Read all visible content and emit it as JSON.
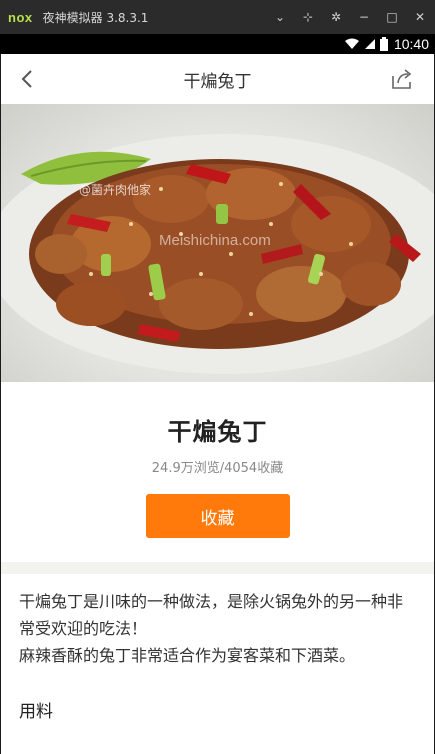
{
  "emulator": {
    "logo": "nox",
    "title": "夜神模拟器 3.8.3.1"
  },
  "status_bar": {
    "time": "10:40"
  },
  "header": {
    "title": "干煸兔丁"
  },
  "hero": {
    "watermark_1": "@菌卉肉他家",
    "watermark_2": "Meishichina.com"
  },
  "recipe": {
    "name": "干煸兔丁",
    "stats": "24.9万浏览/4054收藏",
    "favorite_label": "收藏"
  },
  "description": {
    "line1": "干煸兔丁是川味的一种做法，是除火锅兔外的另一种非常受欢迎的吃法！",
    "line2": "麻辣香酥的兔丁非常适合作为宴客菜和下酒菜。"
  },
  "sections": {
    "ingredients_title": "用料"
  },
  "colors": {
    "accent": "#ff7a0a",
    "emulator_bar": "#2b2b2b"
  }
}
